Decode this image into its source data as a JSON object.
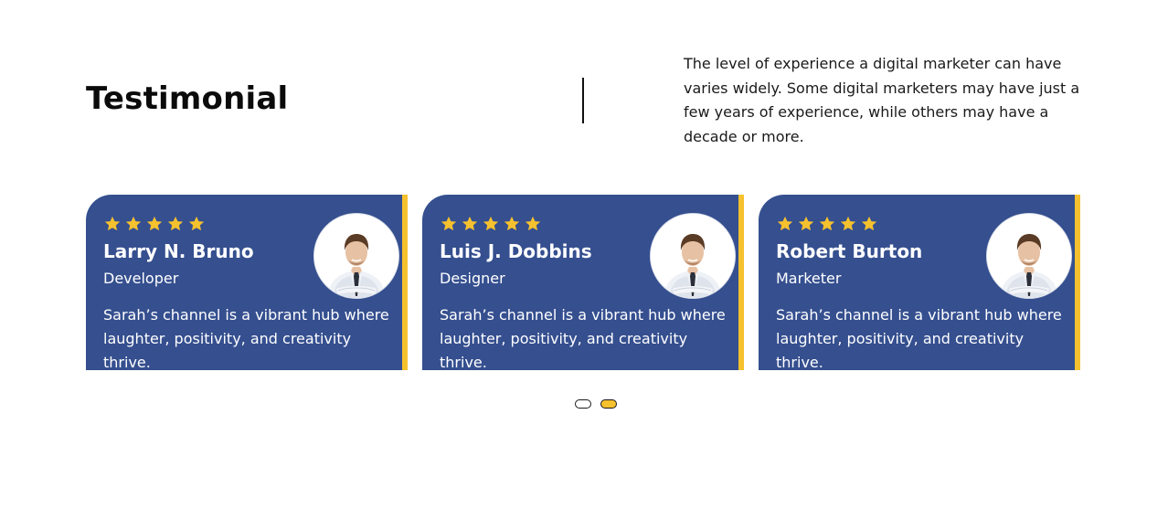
{
  "section": {
    "title": "Testimonial",
    "intro": "The level of experience a digital marketer can have varies widely. Some digital marketers may have just a few years of experience, while others may have a decade or more."
  },
  "colors": {
    "card_background": "#354f8f",
    "accent": "#f6c12e",
    "star": "#f6c12e",
    "text_dark": "#0b0b0b"
  },
  "testimonials": [
    {
      "rating": 5,
      "name": "Larry N. Bruno",
      "role": "Developer",
      "quote": "Sarah’s channel is a vibrant hub where laughter, positivity, and creativity thrive.",
      "avatar_icon": "businessman-avatar"
    },
    {
      "rating": 5,
      "name": "Luis J. Dobbins",
      "role": "Designer",
      "quote": "Sarah’s channel is a vibrant hub where laughter, positivity, and creativity thrive.",
      "avatar_icon": "businessman-avatar"
    },
    {
      "rating": 5,
      "name": "Robert Burton",
      "role": "Marketer",
      "quote": "Sarah’s channel is a vibrant hub where laughter, positivity, and creativity thrive.",
      "avatar_icon": "businessman-avatar"
    }
  ],
  "pagination": {
    "pages": 2,
    "active_page": 2
  }
}
